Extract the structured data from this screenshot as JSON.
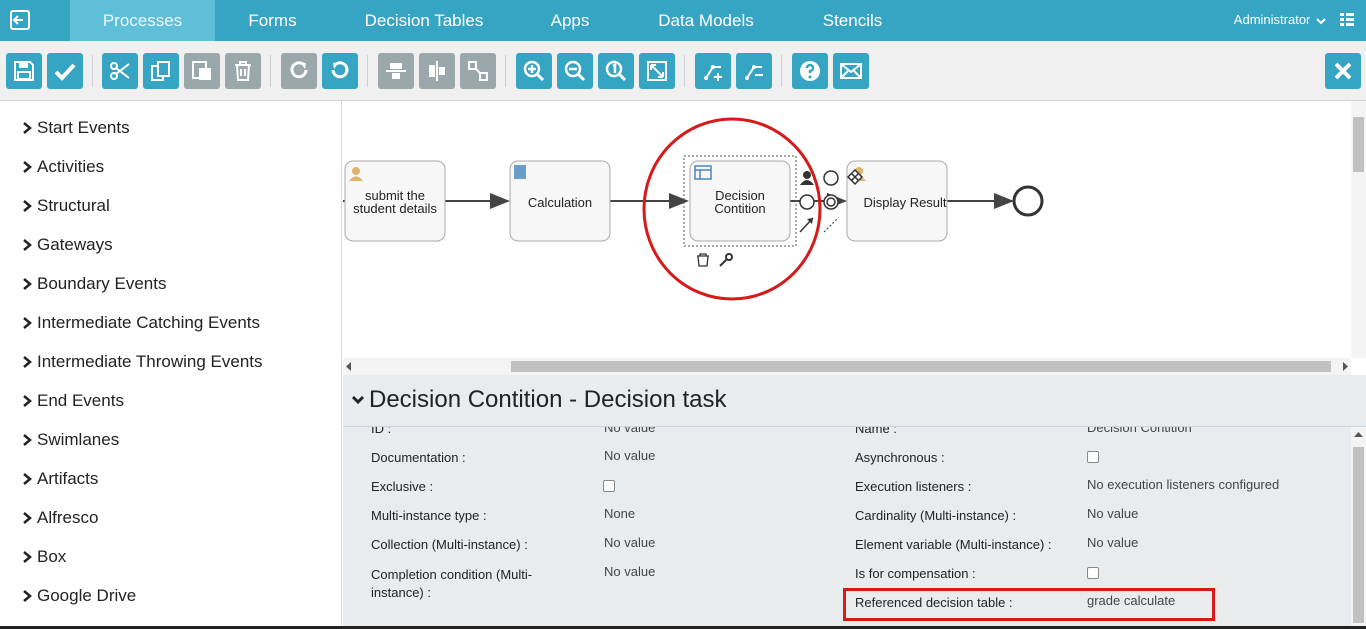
{
  "nav": {
    "tabs": [
      "Processes",
      "Forms",
      "Decision Tables",
      "Apps",
      "Data Models",
      "Stencils"
    ],
    "user": "Administrator"
  },
  "palette": {
    "items": [
      "Start Events",
      "Activities",
      "Structural",
      "Gateways",
      "Boundary Events",
      "Intermediate Catching Events",
      "Intermediate Throwing Events",
      "End Events",
      "Swimlanes",
      "Artifacts",
      "Alfresco",
      "Box",
      "Google Drive"
    ]
  },
  "diagram": {
    "task1": [
      "submit the",
      "student details"
    ],
    "task2": "Calculation",
    "task3": [
      "Decision",
      "Contition"
    ],
    "task4": "Display Result"
  },
  "properties": {
    "title": "Decision Contition - Decision task",
    "left": [
      {
        "label": "ID :",
        "value": "No value"
      },
      {
        "label": "Documentation :",
        "value": "No value"
      },
      {
        "label": "Exclusive :",
        "value": ""
      },
      {
        "label": "Multi-instance type :",
        "value": "None"
      },
      {
        "label": "Collection (Multi-instance) :",
        "value": "No value"
      },
      {
        "label": "Completion condition (Multi-instance) :",
        "value": "No value"
      }
    ],
    "right": [
      {
        "label": "Name :",
        "value": "Decision Contition"
      },
      {
        "label": "Asynchronous :",
        "value": ""
      },
      {
        "label": "Execution listeners :",
        "value": "No execution listeners configured"
      },
      {
        "label": "Cardinality (Multi-instance) :",
        "value": "No value"
      },
      {
        "label": "Element variable (Multi-instance) :",
        "value": "No value"
      },
      {
        "label": "Is for compensation :",
        "value": ""
      },
      {
        "label": "Referenced decision table :",
        "value": "grade calculate"
      }
    ]
  },
  "colors": {
    "accent": "#36a5c4",
    "highlight": "#d61a1a"
  }
}
